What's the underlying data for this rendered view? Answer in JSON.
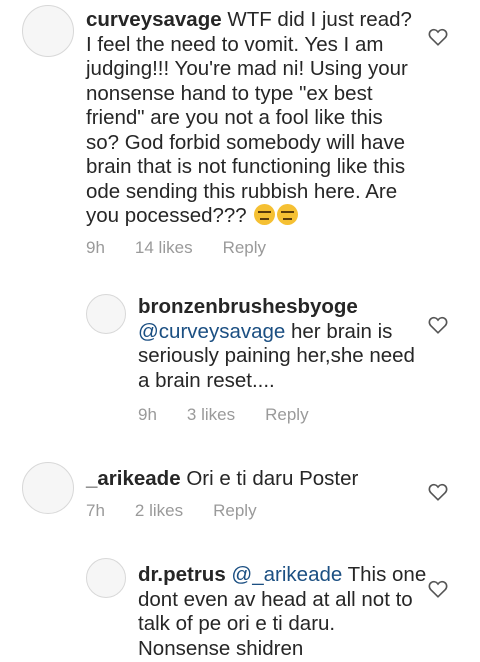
{
  "comments": [
    {
      "username": "curveysavage",
      "body": "WTF did I just read? I feel the need to vomit. Yes I am judging!!! You're mad ni!  Using your nonsense hand to type \"ex best friend\" are you not a fool like this so? God forbid somebody will have brain that is not functioning like this ode sending this rubbish here. Are you pocessed???",
      "emoji": "expressionless-face-emoji",
      "time": "9h",
      "likes": "14 likes",
      "reply_label": "Reply"
    },
    {
      "username": "bronzenbrushesbyoge",
      "mention": "@curveysavage",
      "body": " her brain is seriously paining her,she need a brain reset....",
      "time": "9h",
      "likes": "3 likes",
      "reply_label": "Reply"
    },
    {
      "username": "_arikeade",
      "body": "Ori e ti daru Poster",
      "time": "7h",
      "likes": "2 likes",
      "reply_label": "Reply"
    },
    {
      "username": "dr.petrus",
      "mention": "@_arikeade",
      "body": " This one dont even av head at all not to talk of pe ori e ti daru. Nonsense shidren"
    }
  ],
  "icons": {
    "like": "heart-outline-icon"
  },
  "colors": {
    "text": "#262626",
    "meta": "#9a9a9a",
    "mention": "#1b4f82"
  }
}
